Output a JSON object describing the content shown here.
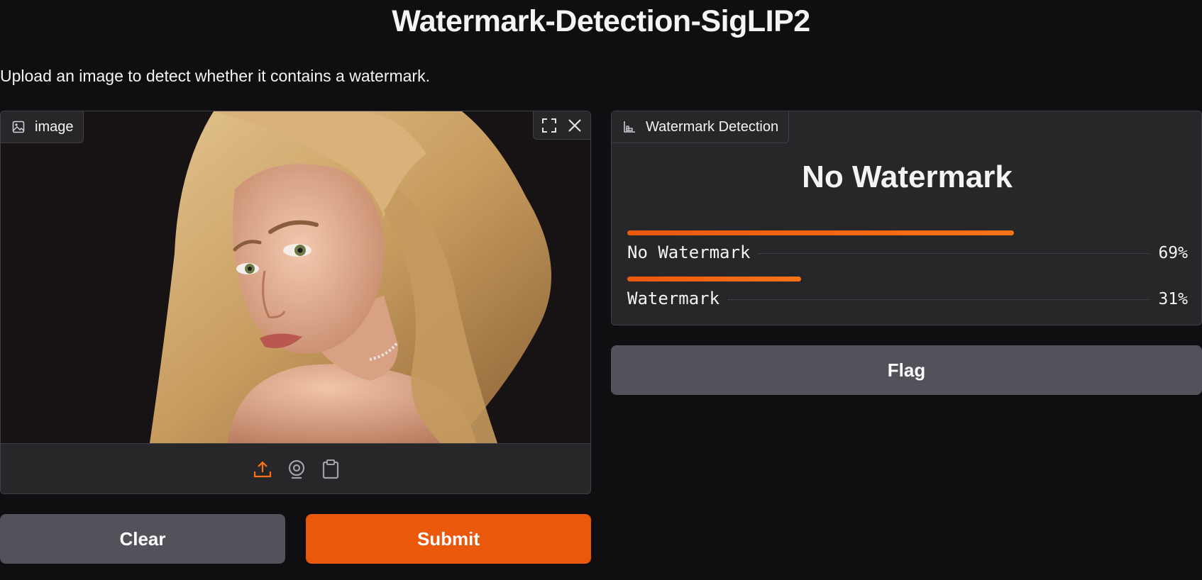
{
  "header": {
    "title": "Watermark-Detection-SigLIP2",
    "description": "Upload an image to detect whether it contains a watermark."
  },
  "input_panel": {
    "label": "image",
    "label_icon": "image-icon",
    "corner_actions": [
      "fullscreen-icon",
      "close-icon"
    ],
    "source_buttons": [
      "upload-icon",
      "webcam-icon",
      "clipboard-icon"
    ],
    "active_source": "upload-icon"
  },
  "output_panel": {
    "label": "Watermark Detection",
    "label_icon": "bar-chart-icon",
    "top_label": "No Watermark",
    "confidences": [
      {
        "label": "No Watermark",
        "value": 0.69,
        "display": "69%"
      },
      {
        "label": "Watermark",
        "value": 0.31,
        "display": "31%"
      }
    ]
  },
  "buttons": {
    "clear": "Clear",
    "submit": "Submit",
    "flag": "Flag"
  },
  "colors": {
    "background": "#0f0f11",
    "panel": "#27272a",
    "border": "#3f3f46",
    "primary": "#ea580c",
    "secondary": "#52525b",
    "text": "#f4f4f5"
  }
}
